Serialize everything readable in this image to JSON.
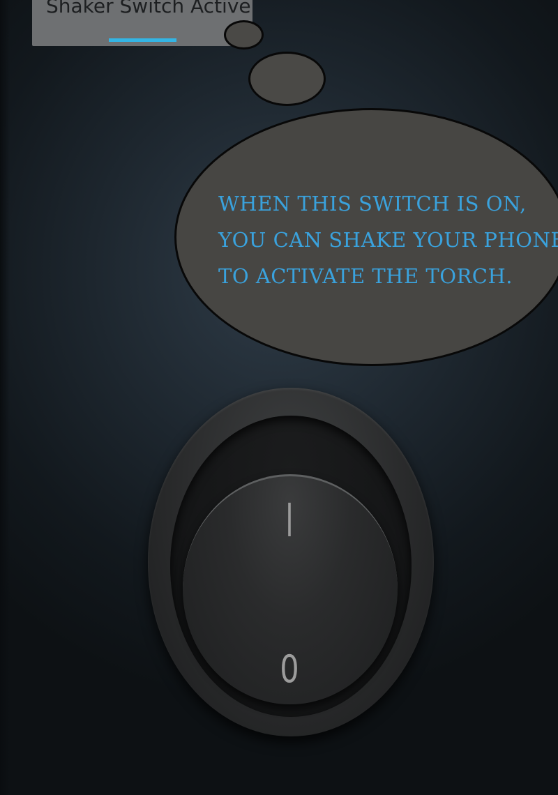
{
  "toast": {
    "text": "Shaker Switch Active"
  },
  "thought_bubble": {
    "lines": [
      "WHEN THIS SWITCH IS ON,",
      "YOU CAN SHAKE YOUR PHONE",
      "TO ACTIVATE THE TORCH."
    ]
  },
  "torch_switch": {
    "on_label": "I",
    "off_label": "0",
    "state": "off"
  },
  "colors": {
    "accent": "#33b5e5",
    "bubble_text": "#3aa2dd",
    "bubble_fill": "#474643",
    "background": "#1d262e"
  }
}
